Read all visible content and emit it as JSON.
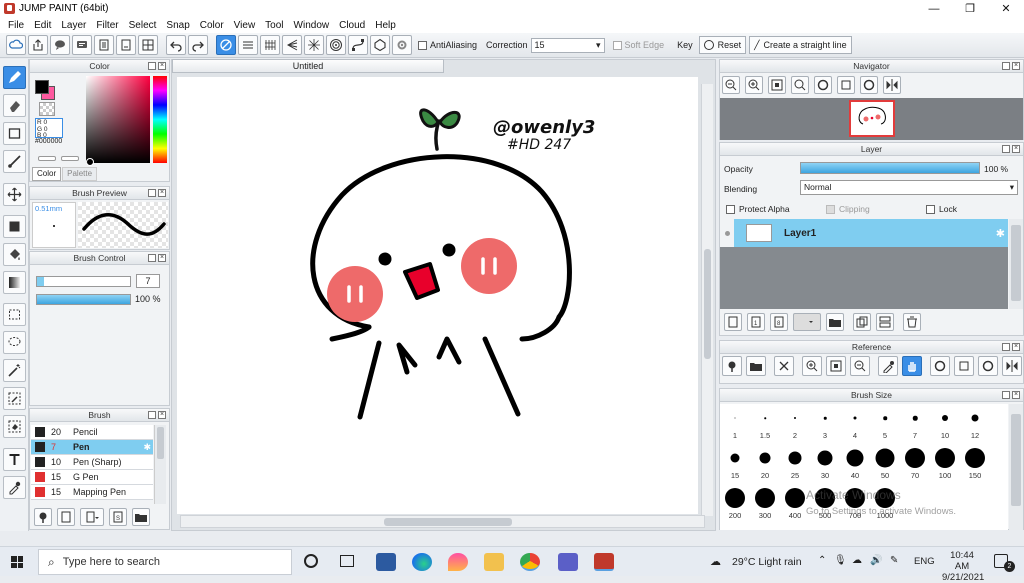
{
  "window": {
    "title": "JUMP PAINT (64bit)",
    "minimize": "—",
    "maximize": "❐",
    "close": "✕"
  },
  "menu": [
    "File",
    "Edit",
    "Layer",
    "Filter",
    "Select",
    "Snap",
    "Color",
    "View",
    "Tool",
    "Window",
    "Cloud",
    "Help"
  ],
  "toolbar": {
    "antialiasing_label": "AntiAliasing",
    "correction_label": "Correction",
    "correction_value": "15",
    "soft_edge_label": "Soft Edge",
    "key_label": "Key",
    "reset_label": "Reset",
    "straight_line_label": "Create a straight line"
  },
  "color_panel": {
    "title": "Color",
    "r": "0",
    "g": "0",
    "b": "0",
    "hex": "#000000",
    "tab_color": "Color",
    "tab_palette": "Palette",
    "primary_color": "#000000",
    "secondary_color": "#ff5aa0"
  },
  "brush_preview": {
    "title": "Brush Preview",
    "size_label": "0.51mm"
  },
  "brush_control": {
    "title": "Brush Control",
    "size_value": "7",
    "opacity_value": "100 %",
    "opacity_fraction": 1.0,
    "size_fraction": 0.07
  },
  "brush_list": {
    "title": "Brush",
    "items": [
      {
        "size": "20",
        "name": "Pencil",
        "color": "#222222"
      },
      {
        "size": "7",
        "name": "Pen",
        "color": "#222222",
        "selected": true
      },
      {
        "size": "10",
        "name": "Pen (Sharp)",
        "color": "#222222"
      },
      {
        "size": "15",
        "name": "G Pen",
        "color": "#e03030"
      },
      {
        "size": "15",
        "name": "Mapping Pen",
        "color": "#e03030"
      }
    ]
  },
  "canvas": {
    "tab_title": "Untitled",
    "signature_line1": "@owenly3",
    "signature_line2": "#HD 247"
  },
  "navigator": {
    "title": "Navigator"
  },
  "layer_panel": {
    "title": "Layer",
    "opacity_label": "Opacity",
    "opacity_value": "100 %",
    "opacity_fraction": 1.0,
    "blending_label": "Blending",
    "blending_value": "Normal",
    "protect_alpha_label": "Protect Alpha",
    "clipping_label": "Clipping",
    "lock_label": "Lock",
    "layer_name": "Layer1"
  },
  "reference_panel": {
    "title": "Reference"
  },
  "brush_size_panel": {
    "title": "Brush Size",
    "sizes": [
      "1",
      "1.5",
      "2",
      "3",
      "4",
      "5",
      "7",
      "10",
      "12",
      "15",
      "20",
      "25",
      "30",
      "40",
      "50",
      "70",
      "100",
      "150",
      "200",
      "300",
      "400",
      "500",
      "700",
      "1000"
    ],
    "watermark_line1": "Activate Windows",
    "watermark_line2": "Go to Settings to activate Windows."
  },
  "taskbar": {
    "search_placeholder": "Type here to search",
    "weather": "29°C  Light rain",
    "language": "ENG",
    "time": "10:44 AM",
    "date": "9/21/2021",
    "notification_count": "2"
  }
}
